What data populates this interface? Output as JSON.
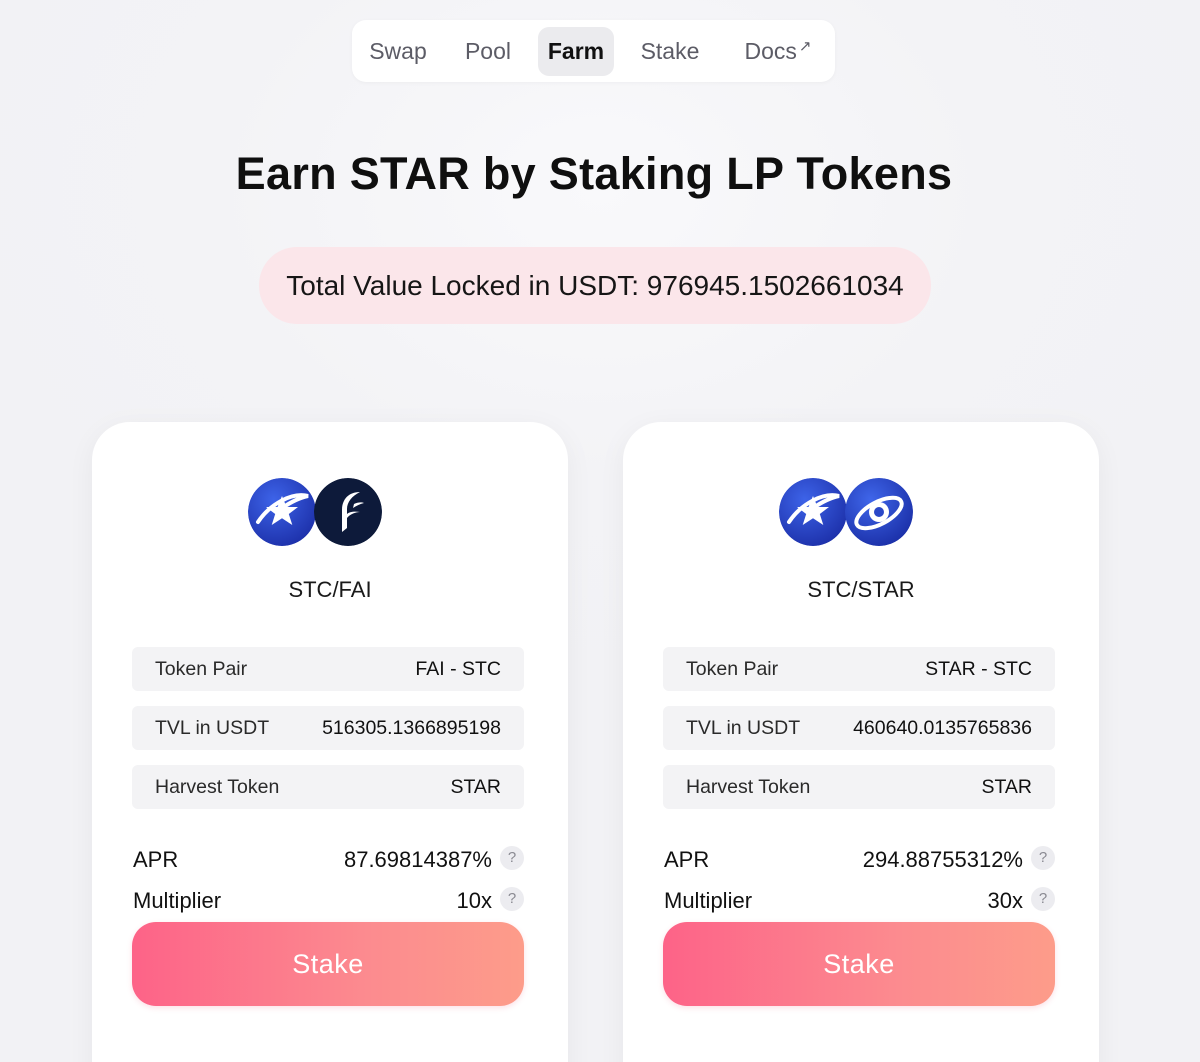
{
  "nav": {
    "items": [
      {
        "label": "Swap"
      },
      {
        "label": "Pool"
      },
      {
        "label": "Farm"
      },
      {
        "label": "Stake"
      },
      {
        "label": "Docs",
        "external_mark": "↗"
      }
    ],
    "active": "Farm"
  },
  "headline": "Earn STAR by Staking LP Tokens",
  "tvl_pill": "Total Value Locked in USDT: 976945.1502661034",
  "farms": [
    {
      "pair": "STC/FAI",
      "token_icons": [
        "stc-star-icon",
        "fai-icon"
      ],
      "rows": [
        {
          "label": "Token Pair",
          "value": "FAI - STC"
        },
        {
          "label": "TVL in USDT",
          "value": "516305.1366895198"
        },
        {
          "label": "Harvest Token",
          "value": "STAR"
        }
      ],
      "apr_label": "APR",
      "apr_value": "87.69814387%",
      "multiplier_label": "Multiplier",
      "multiplier_value": "10x",
      "help_glyph": "?",
      "stake_label": "Stake"
    },
    {
      "pair": "STC/STAR",
      "token_icons": [
        "stc-star-icon",
        "star-orbit-icon"
      ],
      "rows": [
        {
          "label": "Token Pair",
          "value": "STAR - STC"
        },
        {
          "label": "TVL in USDT",
          "value": "460640.0135765836"
        },
        {
          "label": "Harvest Token",
          "value": "STAR"
        }
      ],
      "apr_label": "APR",
      "apr_value": "294.88755312%",
      "multiplier_label": "Multiplier",
      "multiplier_value": "30x",
      "help_glyph": "?",
      "stake_label": "Stake"
    }
  ],
  "colors": {
    "accent_start": "#fd6388",
    "accent_end": "#fd9c8a",
    "tvl_pill_bg": "#fbe6ea",
    "token_blue": "#2a47c8",
    "fai_navy": "#0d1a3a"
  }
}
